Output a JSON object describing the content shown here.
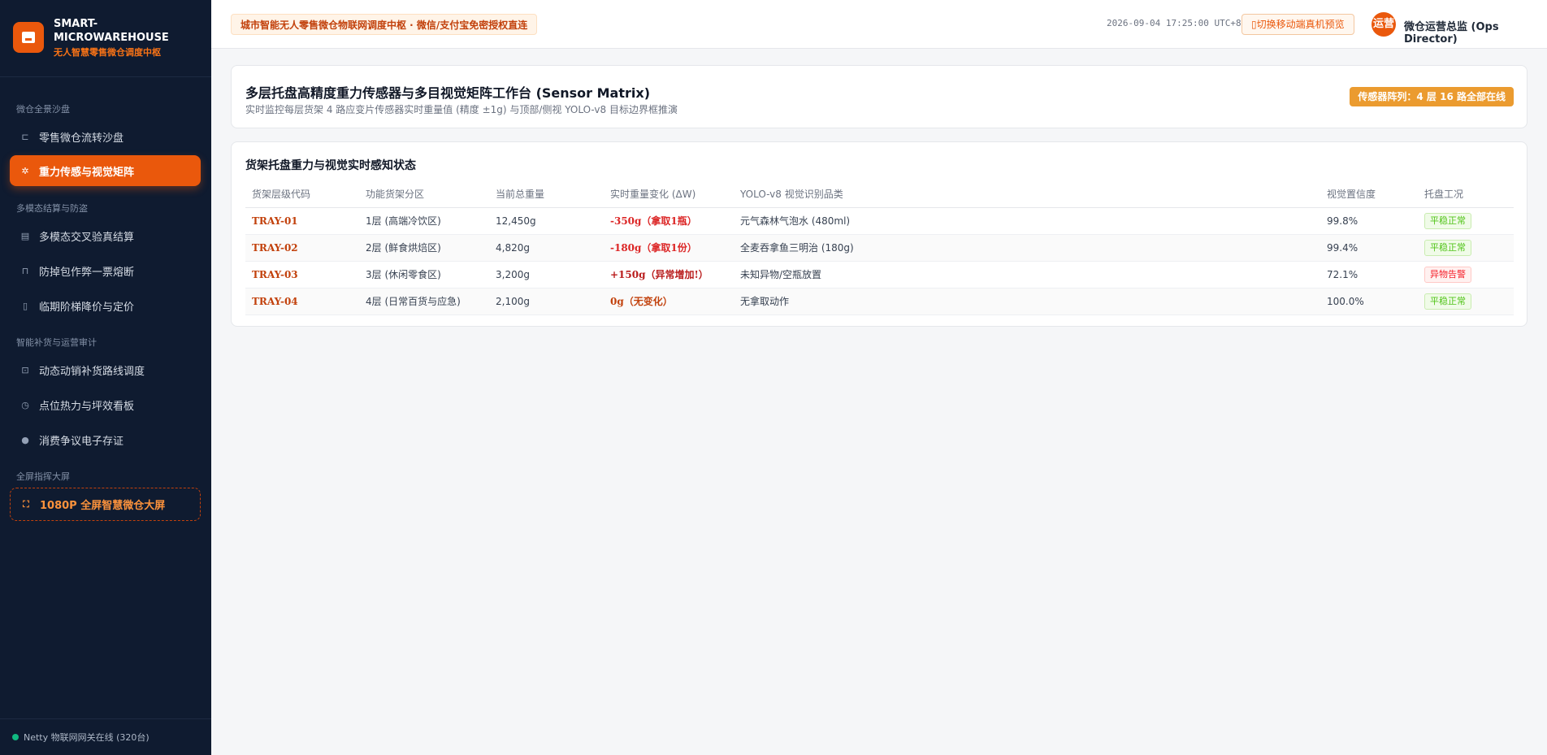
{
  "brand": {
    "title": "SMART-MICROWAREHOUSE",
    "subtitle": "无人智慧零售微仓调度中枢"
  },
  "sidebar": {
    "groups": [
      {
        "label": "微仓全景沙盘"
      },
      {
        "label": "多模态结算与防盗"
      },
      {
        "label": "智能补货与运营审计"
      },
      {
        "label": "全屏指挥大屏"
      }
    ],
    "items": [
      {
        "label": "零售微仓流转沙盘",
        "icon": "shopping-cart-icon"
      },
      {
        "label": "重力传感与视觉矩阵",
        "icon": "gear-icon"
      },
      {
        "label": "多模态交叉验真结算",
        "icon": "layers-icon"
      },
      {
        "label": "防掉包作弊一票熔断",
        "icon": "lock-icon"
      },
      {
        "label": "临期阶梯降价与定价",
        "icon": "clipboard-icon"
      },
      {
        "label": "动态动销补货路线调度",
        "icon": "truck-icon"
      },
      {
        "label": "点位热力与坪效看板",
        "icon": "clock-icon"
      },
      {
        "label": "消费争议电子存证",
        "icon": "user-icon"
      },
      {
        "label": "1080P 全屏智慧微仓大屏",
        "icon": "fullscreen-icon"
      }
    ],
    "footer": "Netty 物联网网关在线 (320台)"
  },
  "topbar": {
    "banner": "城市智能无人零售微仓物联网调度中枢 · 微信/支付宝免密授权直连",
    "datetime": "2026-09-04 17:25:00 UTC+8",
    "mobile_button": "切换移动端真机预览",
    "avatar": "运营",
    "user": "微仓运营总监 (Ops Director)"
  },
  "header_card": {
    "title": "多层托盘高精度重力传感器与多目视觉矩阵工作台 (Sensor Matrix)",
    "subtitle": "实时监控每层货架 4 路应变片传感器实时重量值 (精度 ±1g) 与顶部/侧视 YOLO-v8 目标边界框推演",
    "badge": "传感器阵列：4 层 16 路全部在线"
  },
  "table_card": {
    "title": "货架托盘重力与视觉实时感知状态",
    "columns": [
      "货架层级代码",
      "功能货架分区",
      "当前总重量",
      "实时重量变化 (ΔW)",
      "YOLO-v8 视觉识别品类",
      "视觉置信度",
      "托盘工况"
    ],
    "rows": [
      {
        "code": "TRAY-01",
        "zone": "1层 (高端冷饮区)",
        "weight": "12,450g",
        "delta": "-350g（拿取1瓶）",
        "item": "元气森林气泡水 (480ml)",
        "confidence": "99.8%",
        "status": "平稳正常"
      },
      {
        "code": "TRAY-02",
        "zone": "2层 (鲜食烘焙区)",
        "weight": "4,820g",
        "delta": "-180g（拿取1份）",
        "item": "全麦吞拿鱼三明治 (180g)",
        "confidence": "99.4%",
        "status": "平稳正常"
      },
      {
        "code": "TRAY-03",
        "zone": "3层 (休闲零食区)",
        "weight": "3,200g",
        "delta": "+150g（异常增加!）",
        "item": "未知异物/空瓶放置",
        "confidence": "72.1%",
        "status": "异物告警"
      },
      {
        "code": "TRAY-04",
        "zone": "4层 (日常百货与应急)",
        "weight": "2,100g",
        "delta": "0g（无变化）",
        "item": "无拿取动作",
        "confidence": "100.0%",
        "status": "平稳正常"
      }
    ]
  },
  "colors": {
    "accent": "#ea580c",
    "sidebar_bg": "#0f1b30",
    "ok": "#52c41a",
    "alert": "#f5222d",
    "badge": "#eb9b2f"
  }
}
